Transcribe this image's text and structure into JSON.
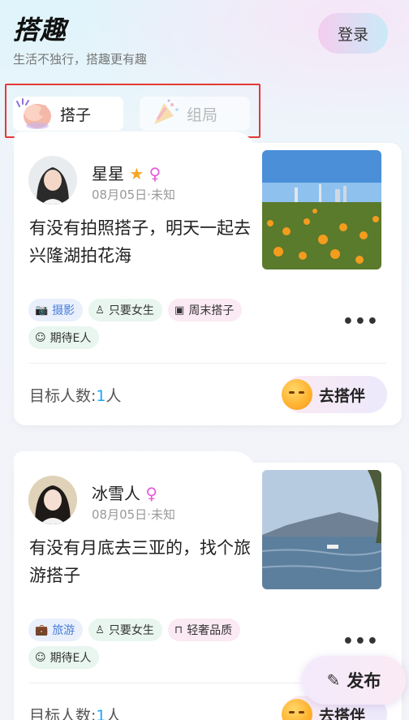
{
  "header": {
    "title": "搭趣",
    "subtitle": "生活不独行，搭趣更有趣",
    "login_label": "登录"
  },
  "tabs": [
    {
      "label": "搭子",
      "active": true,
      "icon": "waving-hand-icon"
    },
    {
      "label": "组局",
      "active": false,
      "icon": "party-popper-icon"
    }
  ],
  "posts": [
    {
      "username": "星星",
      "time": "08月05日·未知",
      "text": "有没有拍照搭子，明天一起去兴隆湖拍花海",
      "tags": [
        {
          "label": "摄影",
          "icon": "camera-icon",
          "style": "blue"
        },
        {
          "label": "只要女生",
          "icon": "dress-icon",
          "style": "green"
        },
        {
          "label": "周末搭子",
          "icon": "calendar-icon",
          "style": "pink"
        },
        {
          "label": "期待E人",
          "icon": "smile-icon",
          "style": "green"
        }
      ],
      "target_label": "目标人数:",
      "target_count": "1",
      "target_unit": "人",
      "join_label": "去搭伴"
    },
    {
      "username": "冰雪人",
      "time": "08月05日·未知",
      "text": "有没有月底去三亚的，找个旅游搭子",
      "tags": [
        {
          "label": "旅游",
          "icon": "suitcase-icon",
          "style": "blue"
        },
        {
          "label": "只要女生",
          "icon": "dress-icon",
          "style": "green"
        },
        {
          "label": "轻奢品质",
          "icon": "bag-icon",
          "style": "pink"
        },
        {
          "label": "期待E人",
          "icon": "smile-icon",
          "style": "green"
        }
      ],
      "target_label": "目标人数:",
      "target_count": "1",
      "target_unit": "人",
      "join_label": "去搭伴"
    }
  ],
  "fab_label": "发布",
  "colors": {
    "accent_blue": "#20a6f0",
    "highlight_border": "#e53935"
  }
}
